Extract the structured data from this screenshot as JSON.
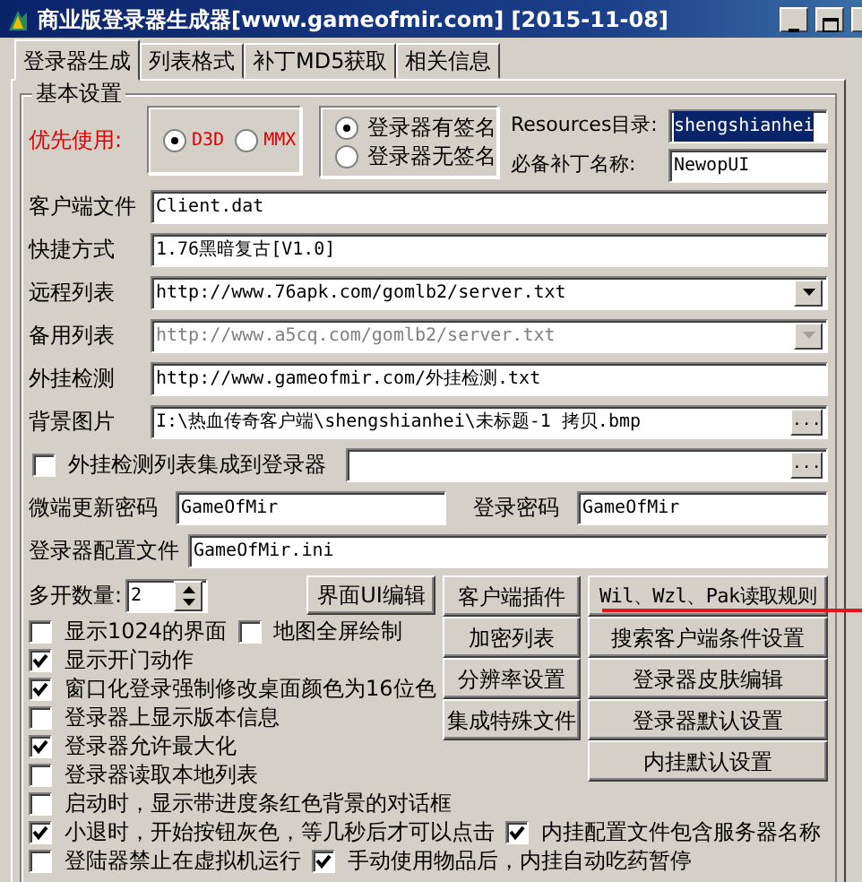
{
  "window": {
    "title": "商业版登录器生成器[www.gameofmir.com] [2015-11-08]"
  },
  "tabs": [
    {
      "label": "登录器生成",
      "selected": true
    },
    {
      "label": "列表格式",
      "selected": false
    },
    {
      "label": "补丁MD5获取",
      "selected": false
    },
    {
      "label": "相关信息",
      "selected": false
    }
  ],
  "group": {
    "title": "基本设置"
  },
  "priority": {
    "label": "优先使用:",
    "options": [
      {
        "label": "D3D",
        "selected": true
      },
      {
        "label": "MMX",
        "selected": false
      }
    ]
  },
  "signature": {
    "options": [
      {
        "label": "登录器有签名",
        "selected": true
      },
      {
        "label": "登录器无签名",
        "selected": false
      }
    ]
  },
  "resources": {
    "label": "Resources目录:",
    "value": "shengshianhei",
    "highlighted": true
  },
  "patch": {
    "label": "必备补丁名称:",
    "value": "NewopUI"
  },
  "fields": [
    {
      "kind": "text",
      "label": "客户端文件",
      "value": "Client.dat"
    },
    {
      "kind": "text",
      "label": "快捷方式",
      "value": "1.76黑暗复古[V1.0]"
    },
    {
      "kind": "dropdown",
      "label": "远程列表",
      "value": "http://www.76apk.com/gomlb2/server.txt",
      "disabled": false
    },
    {
      "kind": "dropdown",
      "label": "备用列表",
      "value": "http://www.a5cq.com/gomlb2/server.txt",
      "disabled": true
    },
    {
      "kind": "text",
      "label": "外挂检测",
      "value": "http://www.gameofmir.com/外挂检测.txt"
    },
    {
      "kind": "browse",
      "label": "背景图片",
      "value": "I:\\热血传奇客户端\\shengshianhei\\未标题-1 拷贝.bmp",
      "button": "..."
    }
  ],
  "integrate": {
    "label": "外挂检测列表集成到登录器",
    "checked": false,
    "button": "..."
  },
  "passwords": [
    {
      "label": "微端更新密码",
      "value": "GameOfMir"
    },
    {
      "label": "登录密码",
      "value": "GameOfMir"
    }
  ],
  "config": {
    "label": "登录器配置文件",
    "value": "GameOfMir.ini"
  },
  "instances": {
    "label": "多开数量:",
    "value": "2"
  },
  "ui_button": "界面UI编辑",
  "buttons_col1": [
    "客户端插件",
    "加密列表",
    "分辨率设置",
    "集成特殊文件"
  ],
  "buttons_col2": [
    "Wil、Wzl、Pak读取规则",
    "搜索客户端条件设置",
    "登录器皮肤编辑",
    "登录器默认设置",
    "内挂默认设置"
  ],
  "options_upper": [
    [
      {
        "label": "显示1024的界面",
        "checked": false
      },
      {
        "label": "地图全屏绘制",
        "checked": false
      }
    ],
    [
      {
        "label": "显示开门动作",
        "checked": true
      }
    ],
    [
      {
        "label": "窗口化登录强制修改桌面颜色为16位色",
        "checked": true
      }
    ],
    [
      {
        "label": "登录器上显示版本信息",
        "checked": false
      }
    ],
    [
      {
        "label": "登录器允许最大化",
        "checked": true
      }
    ],
    [
      {
        "label": "登录器读取本地列表",
        "checked": false
      }
    ]
  ],
  "options_lower": [
    [
      {
        "label": "启动时，显示带进度条红色背景的对话框",
        "checked": false
      }
    ],
    [
      {
        "label": "小退时，开始按钮灰色，等几秒后才可以点击",
        "checked": true
      },
      {
        "label": "内挂配置文件包含服务器名称",
        "checked": true
      }
    ],
    [
      {
        "label": "登陆器禁止在虚拟机运行",
        "checked": false
      },
      {
        "label": "手动使用物品后，内挂自动吃药暂停",
        "checked": true
      }
    ]
  ],
  "annotations": [
    {
      "kind": "arrow"
    }
  ]
}
